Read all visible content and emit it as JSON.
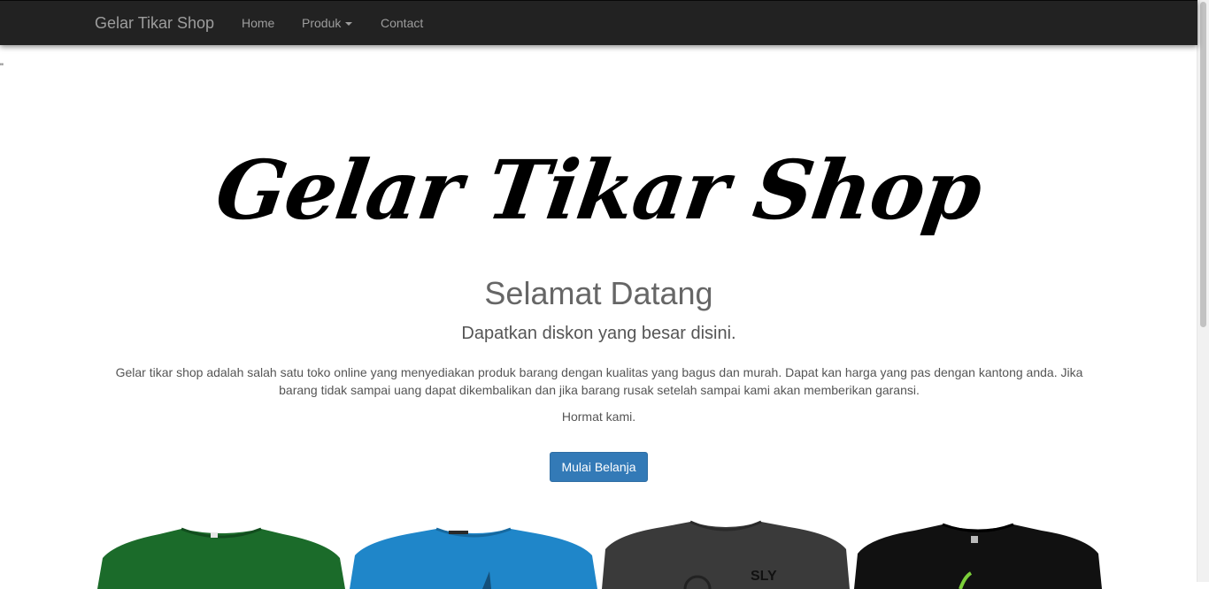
{
  "navbar": {
    "brand": "Gelar Tikar Shop",
    "items": [
      {
        "label": "Home"
      },
      {
        "label": "Produk"
      },
      {
        "label": "Contact"
      }
    ]
  },
  "stray_text": "\"",
  "hero": {
    "logo_text": "Gelar Tikar Shop",
    "title": "Selamat Datang",
    "subtitle": "Dapatkan diskon yang besar disini.",
    "description": "Gelar tikar shop adalah salah satu toko online yang menyediakan produk barang dengan kualitas yang bagus dan murah. Dapat kan harga yang pas dengan kantong anda. Jika barang tidak sampai uang dapat dikembalikan dan jika barang rusak setelah sampai kami akan memberikan garansi.",
    "closing": "Hormat kami.",
    "cta_label": "Mulai Belanja"
  },
  "products": [
    {
      "icon": "green-tshirt-image",
      "color": "#1b6b2a"
    },
    {
      "icon": "blue-tshirt-image",
      "color": "#1f86c9"
    },
    {
      "icon": "grey-tshirt-image",
      "color": "#3a3a3a",
      "print": "SLY"
    },
    {
      "icon": "black-tshirt-image",
      "color": "#111111"
    }
  ],
  "colors": {
    "navbar_bg": "#222222",
    "nav_text": "#9d9d9d",
    "button_primary": "#337ab7"
  }
}
